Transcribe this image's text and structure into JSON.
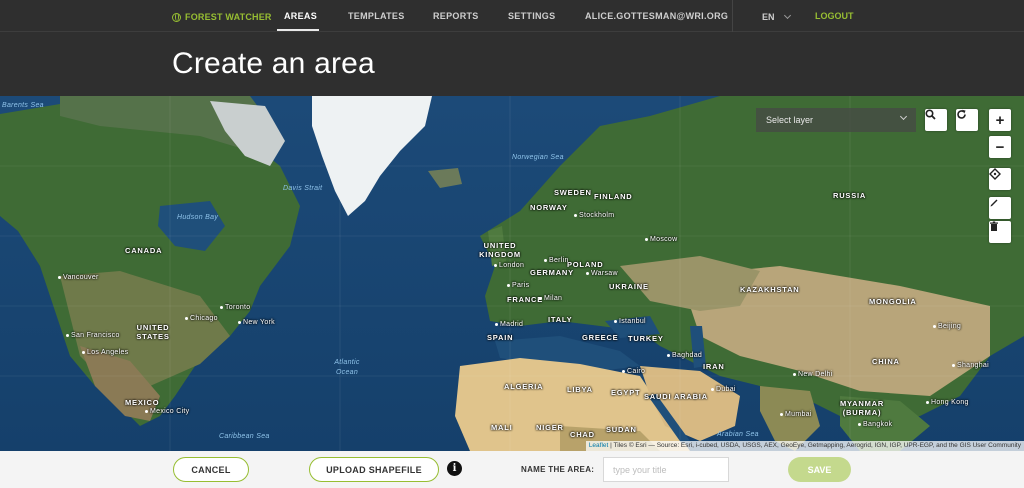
{
  "nav": {
    "brand": "FOREST WATCHER",
    "items": [
      {
        "label": "AREAS",
        "active": true
      },
      {
        "label": "TEMPLATES",
        "active": false
      },
      {
        "label": "REPORTS",
        "active": false
      },
      {
        "label": "SETTINGS",
        "active": false
      }
    ],
    "user": "ALICE.GOTTESMAN@WRI.ORG",
    "language": "EN",
    "logout": "LOGOUT"
  },
  "page": {
    "title": "Create an area"
  },
  "map": {
    "layer_select": {
      "placeholder": "Select layer"
    },
    "controls": {
      "zoom_in": "+",
      "zoom_out": "−"
    },
    "attribution": {
      "leaflet": "Leaflet",
      "text": "| Tiles © Esri — Source: Esri, i-cubed, USDA, USGS, AEX, GeoEye, Getmapping, Aerogrid, IGN, IGP, UPR-EGP, and the GIS User Community"
    },
    "labels": {
      "countries": [
        "CANADA",
        "UNITED STATES",
        "MEXICO",
        "UNITED KINGDOM",
        "SWEDEN",
        "FINLAND",
        "NORWAY",
        "POLAND",
        "GERMANY",
        "FRANCE",
        "SPAIN",
        "ITALY",
        "GREECE",
        "TURKEY",
        "UKRAINE",
        "RUSSIA",
        "KAZAKHSTAN",
        "MONGOLIA",
        "CHINA",
        "IRAN",
        "ALGERIA",
        "LIBYA",
        "EGYPT",
        "SAUDI ARABIA",
        "MALI",
        "NIGER",
        "CHAD",
        "SUDAN",
        "MYANMAR (BURMA)"
      ],
      "seas": [
        "Barents Sea",
        "Norwegian Sea",
        "Davis Strait",
        "Hudson Bay",
        "Atlantic Ocean",
        "Caribbean Sea",
        "Arabian Sea"
      ],
      "cities": [
        "Vancouver",
        "San Francisco",
        "Los Angeles",
        "Chicago",
        "Toronto",
        "New York",
        "Mexico City",
        "London",
        "Paris",
        "Madrid",
        "Milan",
        "Berlin",
        "Warsaw",
        "Stockholm",
        "Moscow",
        "Istanbul",
        "Cairo",
        "Baghdad",
        "Dubai",
        "Mumbai",
        "New Delhi",
        "Beijing",
        "Shanghai",
        "Hong Kong",
        "Bangkok"
      ]
    }
  },
  "footer": {
    "cancel": "CANCEL",
    "upload": "UPLOAD SHAPEFILE",
    "name_label": "NAME THE AREA:",
    "name_placeholder": "type your title",
    "save": "SAVE"
  },
  "colors": {
    "accent": "#97be32",
    "header_bg": "#2f2f2f",
    "save_disabled": "#c4d98d"
  }
}
